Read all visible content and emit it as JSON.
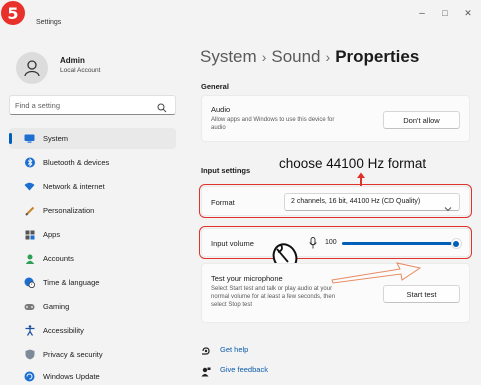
{
  "step_badge": "5",
  "window": {
    "title": "Settings",
    "controls": {
      "minimize": "–",
      "maximize": "□",
      "close": "✕"
    }
  },
  "profile": {
    "name": "Admin",
    "account": "Local Account"
  },
  "search": {
    "placeholder": "Find a setting"
  },
  "sidebar": {
    "items": [
      {
        "label": "System",
        "icon": "system-monitor-icon",
        "active": true
      },
      {
        "label": "Bluetooth & devices",
        "icon": "bluetooth-icon",
        "active": false
      },
      {
        "label": "Network & internet",
        "icon": "wifi-icon",
        "active": false
      },
      {
        "label": "Personalization",
        "icon": "brush-icon",
        "active": false
      },
      {
        "label": "Apps",
        "icon": "apps-icon",
        "active": false
      },
      {
        "label": "Accounts",
        "icon": "accounts-icon",
        "active": false
      },
      {
        "label": "Time & language",
        "icon": "globe-clock-icon",
        "active": false
      },
      {
        "label": "Gaming",
        "icon": "gamepad-icon",
        "active": false
      },
      {
        "label": "Accessibility",
        "icon": "accessibility-icon",
        "active": false
      },
      {
        "label": "Privacy & security",
        "icon": "shield-icon",
        "active": false
      },
      {
        "label": "Windows Update",
        "icon": "update-icon",
        "active": false
      }
    ]
  },
  "breadcrumb": {
    "part1": "System",
    "part2": "Sound",
    "current": "Properties",
    "separator": "›"
  },
  "general": {
    "heading": "General",
    "audio_title": "Audio",
    "audio_desc_line1": "Allow apps and Windows to use this device for",
    "audio_desc_line2": "audio",
    "dont_allow_label": "Don't allow"
  },
  "input_settings": {
    "heading": "Input settings",
    "format_label": "Format",
    "format_value": "2 channels, 16 bit, 44100 Hz (CD Quality)",
    "volume_label": "Input volume",
    "volume_value": "100",
    "volume_level": 1.0,
    "test_title": "Test your microphone",
    "test_desc_line1": "Select Start test and talk or play audio at your",
    "test_desc_line2": "normal volume for at least a few seconds, then",
    "test_desc_line3": "select Stop test",
    "start_test_label": "Start test"
  },
  "annotation": {
    "text": "choose 44100 Hz format",
    "color": "#e0312a"
  },
  "footer": {
    "get_help": "Get help",
    "give_feedback": "Give feedback"
  },
  "colors": {
    "accent": "#005fb8",
    "link": "#0b5cad",
    "annotation_red": "#e0312a"
  }
}
